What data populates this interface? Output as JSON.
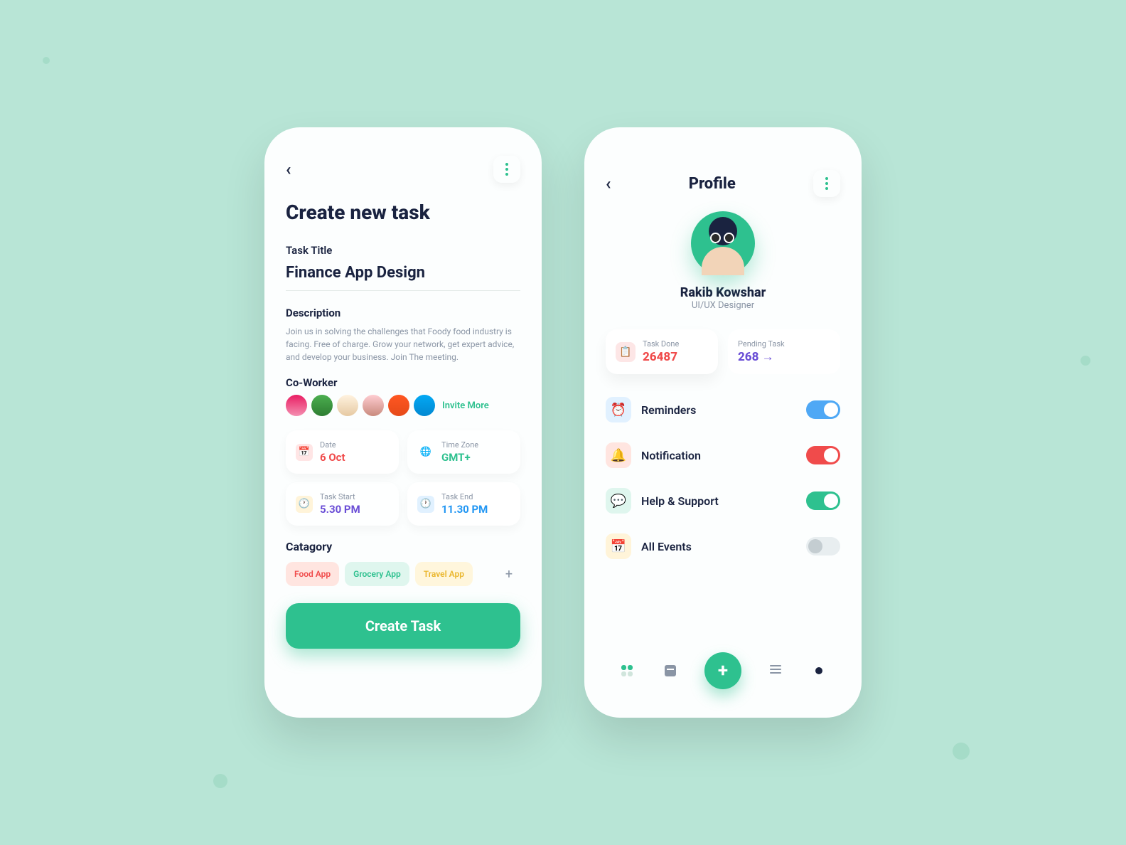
{
  "left": {
    "title": "Create new task",
    "taskTitleLabel": "Task Title",
    "taskTitle": "Finance App Design",
    "descLabel": "Description",
    "desc": "Join us in solving the challenges that Foody food industry is facing. Free of charge. Grow your network, get expert advice, and develop your business. Join The meeting.",
    "coworkerLabel": "Co-Worker",
    "invite": "Invite More",
    "dateLabel": "Date",
    "date": "6 Oct",
    "tzLabel": "Time Zone",
    "tz": "GMT+",
    "startLabel": "Task Start",
    "start": "5.30 PM",
    "endLabel": "Task End",
    "end": "11.30 PM",
    "categoryLabel": "Catagory",
    "categories": [
      "Food App",
      "Grocery App",
      "Travel App"
    ],
    "cta": "Create Task"
  },
  "right": {
    "title": "Profile",
    "name": "Rakib Kowshar",
    "role": "UI/UX Designer",
    "taskDoneLabel": "Task Done",
    "taskDone": "26487",
    "pendingLabel": "Pending Task",
    "pending": "268 →",
    "settings": {
      "reminders": "Reminders",
      "notification": "Notification",
      "help": "Help & Support",
      "events": "All Events"
    }
  }
}
